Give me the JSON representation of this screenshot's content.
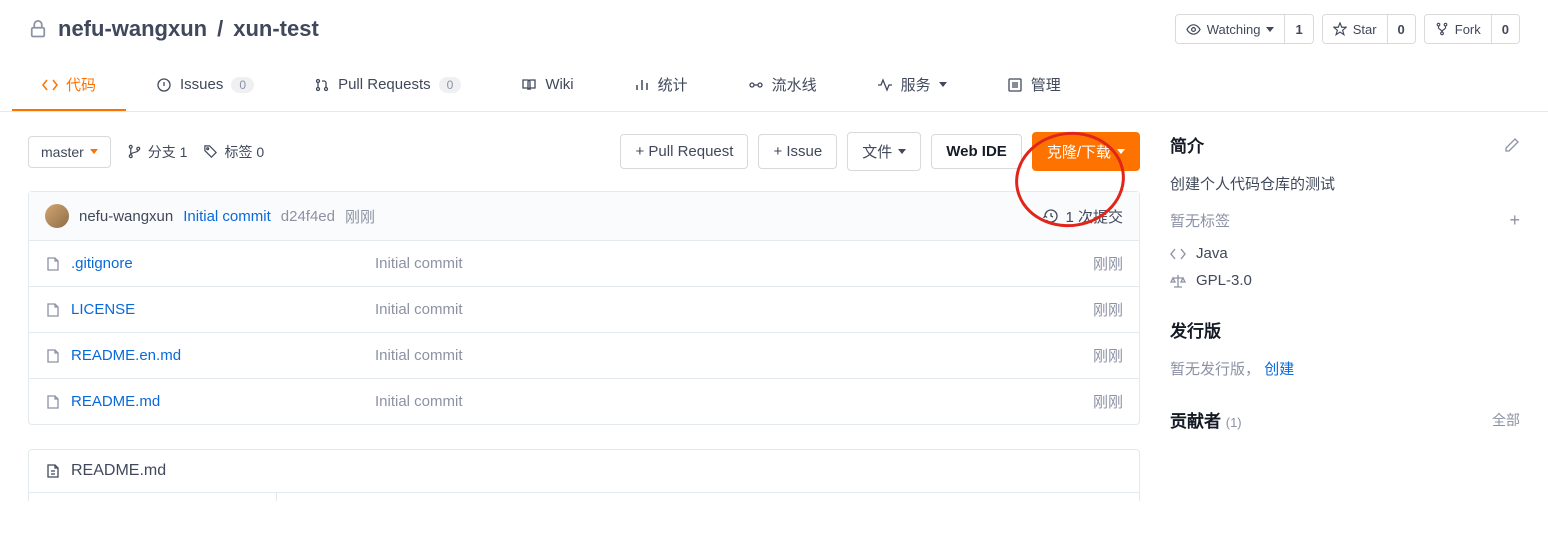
{
  "header": {
    "owner": "nefu-wangxun",
    "repo": "xun-test",
    "watching_label": "Watching",
    "watching_count": "1",
    "star_label": "Star",
    "star_count": "0",
    "fork_label": "Fork",
    "fork_count": "0"
  },
  "nav": {
    "code": "代码",
    "issues": "Issues",
    "issues_count": "0",
    "pr": "Pull Requests",
    "pr_count": "0",
    "wiki": "Wiki",
    "stats": "统计",
    "pipeline": "流水线",
    "services": "服务",
    "manage": "管理"
  },
  "toolbar": {
    "branch_selected": "master",
    "branches_label": "分支 1",
    "tags_label": "标签 0",
    "pull_request": "+ Pull Request",
    "issue": "+ Issue",
    "file": "文件",
    "web_ide": "Web IDE",
    "clone_download": "克隆/下载"
  },
  "commit": {
    "author": "nefu-wangxun",
    "message": "Initial commit",
    "sha": "d24f4ed",
    "time": "刚刚",
    "count": "1 次提交"
  },
  "files": [
    {
      "name": ".gitignore",
      "commit": "Initial commit",
      "time": "刚刚"
    },
    {
      "name": "LICENSE",
      "commit": "Initial commit",
      "time": "刚刚"
    },
    {
      "name": "README.en.md",
      "commit": "Initial commit",
      "time": "刚刚"
    },
    {
      "name": "README.md",
      "commit": "Initial commit",
      "time": "刚刚"
    }
  ],
  "readme": {
    "title": "README.md"
  },
  "sidebar": {
    "intro_title": "简介",
    "intro_desc": "创建个人代码仓库的测试",
    "no_tags": "暂无标签",
    "language": "Java",
    "license": "GPL-3.0",
    "releases_title": "发行版",
    "no_releases": "暂无发行版，",
    "create_release": "创建",
    "contributors_title": "贡献者",
    "contributors_count": "(1)",
    "all": "全部"
  }
}
